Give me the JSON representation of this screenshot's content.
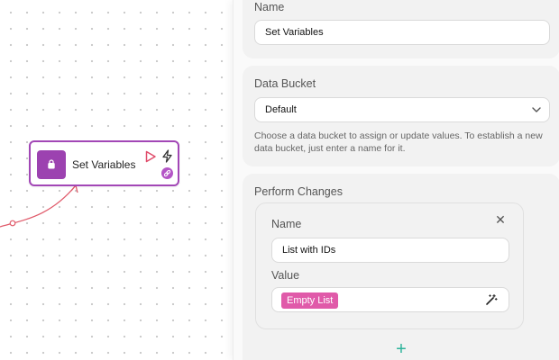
{
  "canvas": {
    "node": {
      "title": "Set Variables",
      "icon": "bag-icon",
      "accent": "#a247b6",
      "actions": [
        "play-icon",
        "bolt-icon",
        "link-icon"
      ]
    },
    "edge_color": "#e05a6a"
  },
  "panel": {
    "name_section": {
      "label": "Name",
      "value": "Set Variables"
    },
    "bucket_section": {
      "label": "Data Bucket",
      "selected": "Default",
      "help": "Choose a data bucket to assign or update values. To establish a new data bucket, just enter a name for it."
    },
    "changes_section": {
      "label": "Perform Changes",
      "items": [
        {
          "name_label": "Name",
          "name_value": "List with IDs",
          "value_label": "Value",
          "value_tag": "Empty List"
        }
      ],
      "add_icon": "plus-icon",
      "add_color": "#2cb39a"
    }
  }
}
